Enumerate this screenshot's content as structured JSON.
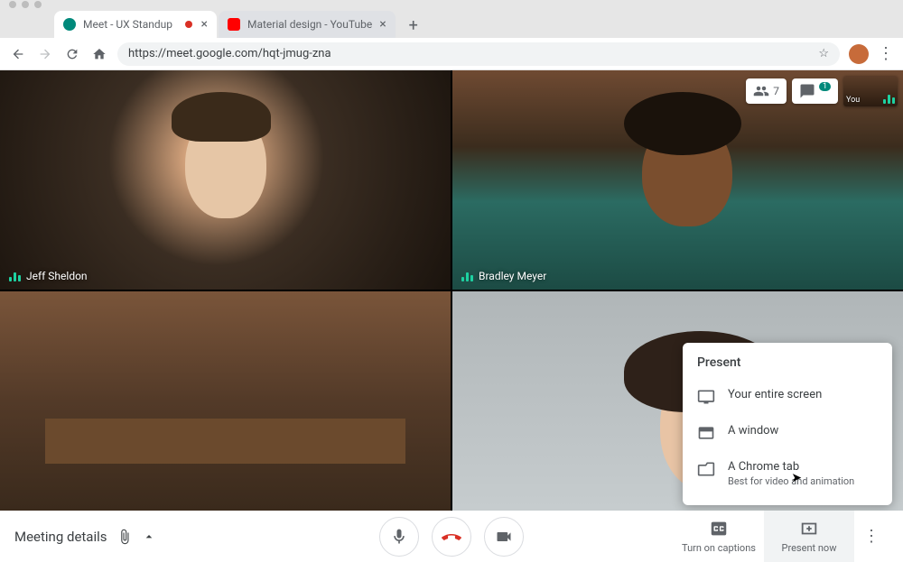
{
  "browser": {
    "tabs": [
      {
        "title": "Meet - UX Standup",
        "favicon_color": "#00897b",
        "active": true
      },
      {
        "title": "Material design - YouTube",
        "favicon_color": "#ff0000",
        "active": false
      }
    ],
    "url": "https://meet.google.com/hqt-jmug-zna"
  },
  "overlay": {
    "participants_count": "7",
    "chat_badge": "1",
    "self_label": "You"
  },
  "tiles": [
    {
      "name": "Jeff Sheldon"
    },
    {
      "name": "Bradley Meyer"
    },
    {
      "name": ""
    },
    {
      "name": ""
    }
  ],
  "present_menu": {
    "title": "Present",
    "items": [
      {
        "label": "Your entire screen",
        "sub": ""
      },
      {
        "label": "A window",
        "sub": ""
      },
      {
        "label": "A Chrome tab",
        "sub": "Best for video and animation"
      }
    ]
  },
  "bottombar": {
    "meeting_details": "Meeting details",
    "captions": "Turn on captions",
    "present": "Present now"
  }
}
